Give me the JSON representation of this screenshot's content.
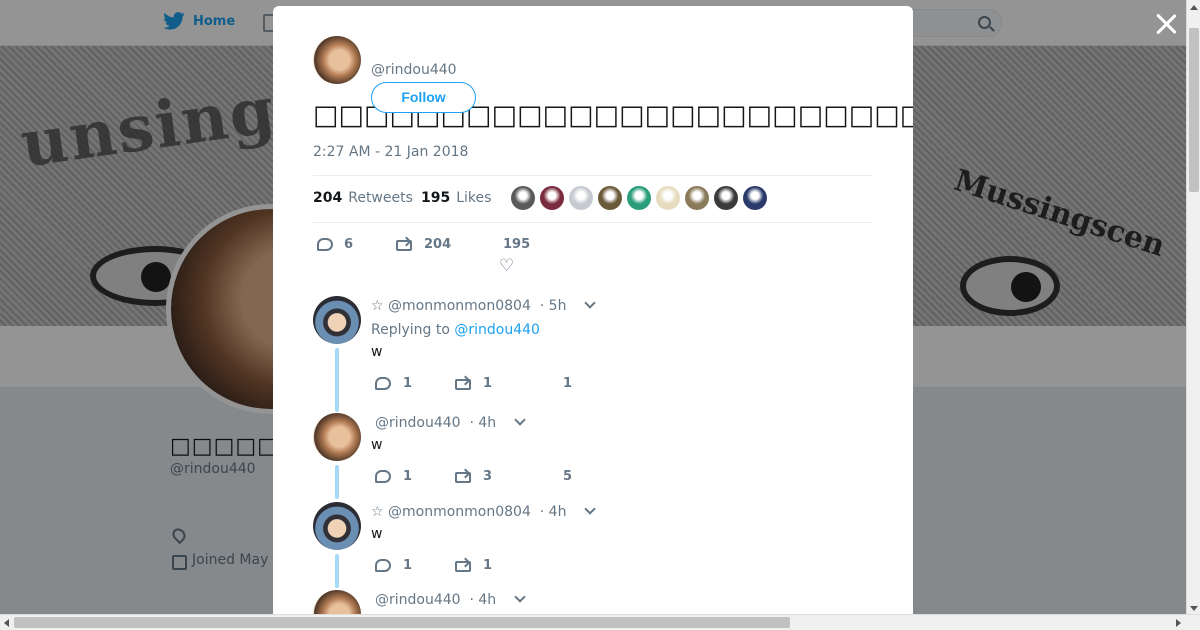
{
  "nav": {
    "home_label": "Home"
  },
  "profile": {
    "name": "□□□□□□□",
    "handle": "@rindou440",
    "joined": "Joined May"
  },
  "banner": {
    "text": "unsingw",
    "cap_text": "Mussingscen"
  },
  "tweet": {
    "author_handle": "@rindou440",
    "follow_label": "Follow",
    "text": "□□□□□□□□□□□□□□□□□□□□□□□□□□□□□□□□□□□…□□□□□□□□□□□□□□□□□□□□□□□□□□□□□□□□□□□□□□□□□□□□□□□□□",
    "time": "2:27 AM - 21 Jan 2018",
    "retweets_count": "204",
    "retweets_label": "Retweets",
    "likes_count": "195",
    "likes_label": "Likes",
    "reply_count": "6",
    "rt_count": "204",
    "like_count": "195"
  },
  "likers_colors": [
    "#5a5a5a",
    "#7a2b3c",
    "#c7cbd1",
    "#6b5a3a",
    "#2a9d7a",
    "#e8dcc0",
    "#8a7a5a",
    "#3a3a3a",
    "#2a3a6a"
  ],
  "replies": [
    {
      "handle": "☆ @monmonmon0804",
      "time": "· 5h",
      "replying_prefix": "Replying to",
      "replying_to": "@rindou440",
      "text": "w",
      "reply_count": "1",
      "rt_count": "1",
      "like_count": "1"
    },
    {
      "handle": "@rindou440",
      "time": "· 4h",
      "text": "w",
      "reply_count": "1",
      "rt_count": "3",
      "like_count": "5"
    },
    {
      "handle": "☆ @monmonmon0804",
      "time": "· 4h",
      "text": "w",
      "reply_count": "1",
      "rt_count": "1",
      "like_count": ""
    },
    {
      "handle": "@rindou440",
      "time": "· 4h"
    }
  ],
  "colors": {
    "accent": "#1da1f2",
    "thread_line": "#a6d8f8"
  }
}
